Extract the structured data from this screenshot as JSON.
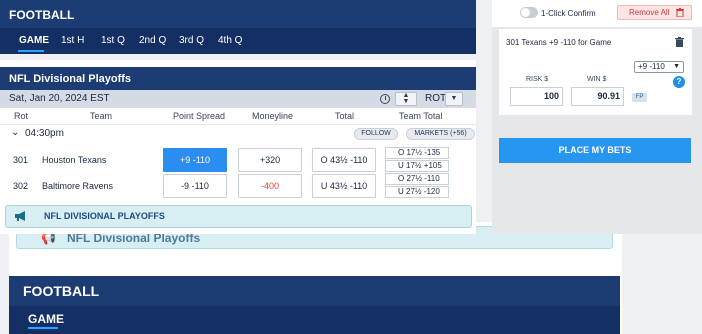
{
  "background": {
    "promo_text": "NFL Divisional Playoffs",
    "sport_title": "FOOTBALL",
    "tab_label": "GAME"
  },
  "sport": {
    "title": "FOOTBALL",
    "tabs": [
      {
        "label": "GAME",
        "active": true
      },
      {
        "label": "1st H",
        "active": false
      },
      {
        "label": "1st Q",
        "active": false
      },
      {
        "label": "2nd Q",
        "active": false
      },
      {
        "label": "3rd Q",
        "active": false
      },
      {
        "label": "4th Q",
        "active": false
      }
    ]
  },
  "league": {
    "title": "NFL Divisional Playoffs",
    "date": "Sat, Jan 20, 2024 EST",
    "sort_label": "ROT"
  },
  "columns": {
    "rot": "Rot",
    "team": "Team",
    "point_spread": "Point Spread",
    "moneyline": "Moneyline",
    "total": "Total",
    "team_total": "Team Total"
  },
  "event": {
    "time": "04:30pm",
    "follow_label": "FOLLOW",
    "markets_label": "MARKETS (+56)",
    "teams": [
      {
        "rot": "301",
        "name": "Houston Texans",
        "spread": "+9 -110",
        "moneyline": "+320",
        "total": "O 43½ -110",
        "team_total_over": "O 17½ -135",
        "team_total_under": "U 17½ +105"
      },
      {
        "rot": "302",
        "name": "Baltimore Ravens",
        "spread": "-9 -110",
        "moneyline": "-400",
        "total": "U 43½ -110",
        "team_total_over": "O 27½ -110",
        "team_total_under": "U 27½ -120"
      }
    ]
  },
  "promo": {
    "text": "NFL DIVISIONAL PLAYOFFS"
  },
  "bet_slip": {
    "one_click_label": "1-Click Confirm",
    "one_click_enabled": false,
    "remove_all_label": "Remove All",
    "bet_description": "301 Texans +9 -110 for Game",
    "line_value": "+9 -110",
    "risk_label": "RISK $",
    "win_label": "WIN $",
    "risk_value": "100",
    "win_value": "90.91",
    "fp_label": "FP",
    "help_label": "?",
    "place_bets_label": "PLACE MY BETS"
  },
  "colors": {
    "header_navy": "#1d3c73",
    "tabs_navy": "#142f63",
    "accent_blue": "#2b8df0",
    "negative_red": "#e1473c",
    "promo_bg": "#d7eef3"
  }
}
